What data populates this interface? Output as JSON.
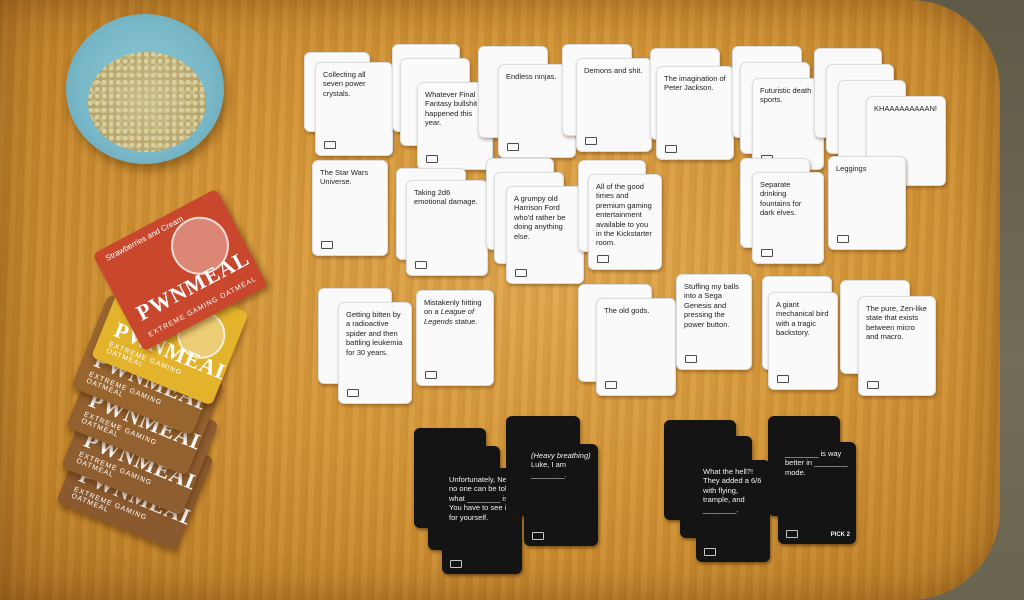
{
  "white_cards": [
    {
      "text": "Collecting all seven power crystals."
    },
    {
      "text": "Whatever Final Fantasy bullshit happened this year."
    },
    {
      "text": "Endless ninjas."
    },
    {
      "text": "Demons and shit."
    },
    {
      "text": "The imagination of Peter Jackson."
    },
    {
      "text": "Futuristic death sports."
    },
    {
      "text": "KHAAAAAAAAAN!"
    },
    {
      "text": "The Star Wars Universe."
    },
    {
      "text": "Taking 2d6 emotional damage."
    },
    {
      "text": "A grumpy old Harrison Ford who'd rather be doing anything else."
    },
    {
      "text": "All of the good times and premium gaming entertainment available to you in the Kickstarter room."
    },
    {
      "text": "Separate drinking fountains for dark elves."
    },
    {
      "text": "Leggings"
    },
    {
      "text": "Getting bitten by a radioactive spider and then battling leukemia for 30 years."
    },
    {
      "text_before": "Mistakenly hitting on a ",
      "text_italic": "League of Legends",
      "text_after": " statue."
    },
    {
      "text": "The old gods."
    },
    {
      "text": "Stuffing my balls into a Sega Genesis and pressing the power button."
    },
    {
      "text": "A giant mechanical bird with a tragic backstory."
    },
    {
      "text": "The pure, Zen-like state that exists between micro and macro."
    }
  ],
  "black_cards": [
    {
      "text_before": "Unfortunately, Neo, no one can be told what ",
      "text_blank": "________",
      "text_after": " is. You have to see it for yourself."
    },
    {
      "text_italic": "(Heavy breathing)",
      "text_after": " Luke, I am ________."
    },
    {
      "text": "What the hell?! They added a 6/6 with flying, trample, and ________."
    },
    {
      "text_blank": "________",
      "text_after": " is way better in ________ mode.",
      "pick": "PICK 2"
    }
  ],
  "packets": {
    "name": "PWNMEAL",
    "tagline": "EXTREME GAMING OATMEAL",
    "flavor": "Strawberries and Cream",
    "colors": [
      "#c9472d",
      "#e2b32b",
      "#8a5a2e",
      "#8a5a2e",
      "#8a5a2e"
    ]
  },
  "colors": {
    "table": "#d49638",
    "bowl": "#79b8c8",
    "white_card": "#fafafa",
    "black_card": "#141414"
  }
}
